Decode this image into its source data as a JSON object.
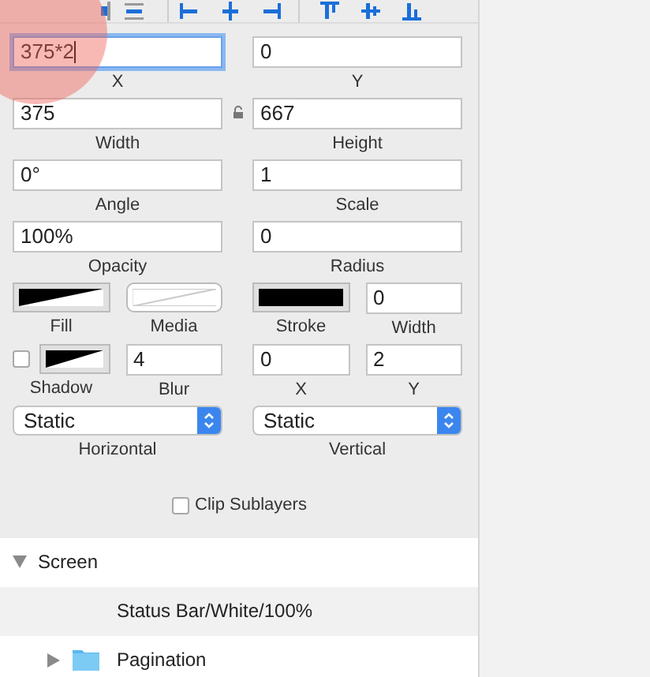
{
  "inspector": {
    "rows": [
      {
        "items": [
          {
            "kind": "field",
            "value": "375*2",
            "label": "X",
            "focused": true
          },
          {
            "kind": "field",
            "value": "0",
            "label": "Y",
            "focused": false
          }
        ]
      },
      {
        "linked": true,
        "items": [
          {
            "kind": "field",
            "value": "375",
            "label": "Width",
            "focused": false
          },
          {
            "kind": "field",
            "value": "667",
            "label": "Height",
            "focused": false
          }
        ]
      },
      {
        "items": [
          {
            "kind": "field",
            "value": "0°",
            "label": "Angle",
            "focused": false
          },
          {
            "kind": "field",
            "value": "1",
            "label": "Scale",
            "focused": false
          }
        ]
      },
      {
        "items": [
          {
            "kind": "field",
            "value": "100%",
            "label": "Opacity",
            "focused": false
          },
          {
            "kind": "field",
            "value": "0",
            "label": "Radius",
            "focused": false
          }
        ]
      },
      {
        "items": [
          {
            "kind": "gradient_swatch",
            "label": "Fill"
          },
          {
            "kind": "media_swatch",
            "label": "Media"
          },
          {
            "kind": "solid_swatch",
            "label": "Stroke"
          },
          {
            "kind": "field",
            "value": "0",
            "label": "Width",
            "focused": false
          }
        ]
      },
      {
        "items": [
          {
            "kind": "shadow",
            "label": "Shadow",
            "checked": false
          },
          {
            "kind": "field",
            "value": "4",
            "label": "Blur",
            "focused": false
          },
          {
            "kind": "field",
            "value": "0",
            "label": "X",
            "focused": false
          },
          {
            "kind": "field",
            "value": "2",
            "label": "Y",
            "focused": false
          }
        ]
      },
      {
        "items": [
          {
            "kind": "select",
            "value": "Static",
            "label": "Horizontal"
          },
          {
            "kind": "select",
            "value": "Static",
            "label": "Vertical"
          }
        ]
      }
    ],
    "clip_sublayers": {
      "label": "Clip Sublayers",
      "checked": false
    }
  },
  "layers": [
    {
      "name": "Screen",
      "expanded": true,
      "selected": false,
      "children": [
        {
          "name": "Status Bar/White/100%",
          "kind": "layer",
          "selected": true
        },
        {
          "name": "Pagination",
          "kind": "folder",
          "expanded": false,
          "selected": false
        }
      ]
    }
  ]
}
